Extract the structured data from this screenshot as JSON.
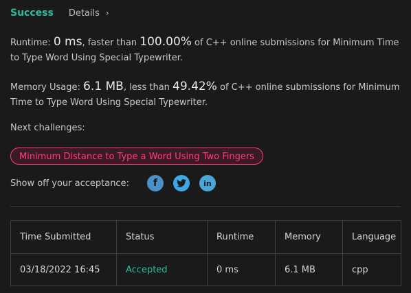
{
  "header": {
    "status": "Success",
    "details_label": "Details",
    "chevron": "›"
  },
  "runtime": {
    "label": "Runtime: ",
    "value": "0 ms",
    "comparison": ", faster than ",
    "percent": "100.00%",
    "suffix": " of C++ online submissions for Minimum Time to Type Word Using Special Typewriter."
  },
  "memory": {
    "label": "Memory Usage: ",
    "value": "6.1 MB",
    "comparison": ", less than ",
    "percent": "49.42%",
    "suffix": " of C++ online submissions for Minimum Time to Type Word Using Special Typewriter."
  },
  "next": {
    "label": "Next challenges:",
    "challenges": [
      "Minimum Distance to Type a Word Using Two Fingers"
    ]
  },
  "share": {
    "label": "Show off your acceptance:",
    "icons": [
      "facebook-icon",
      "twitter-icon",
      "linkedin-icon"
    ]
  },
  "table": {
    "columns": [
      "Time Submitted",
      "Status",
      "Runtime",
      "Memory",
      "Language"
    ],
    "rows": [
      {
        "time": "03/18/2022 16:45",
        "status": "Accepted",
        "runtime": "0 ms",
        "memory": "6.1 MB",
        "language": "cpp"
      }
    ]
  },
  "colors": {
    "background": "#1a1a1a",
    "success": "#2cbb9f",
    "challenge": "#ff3d7f"
  }
}
